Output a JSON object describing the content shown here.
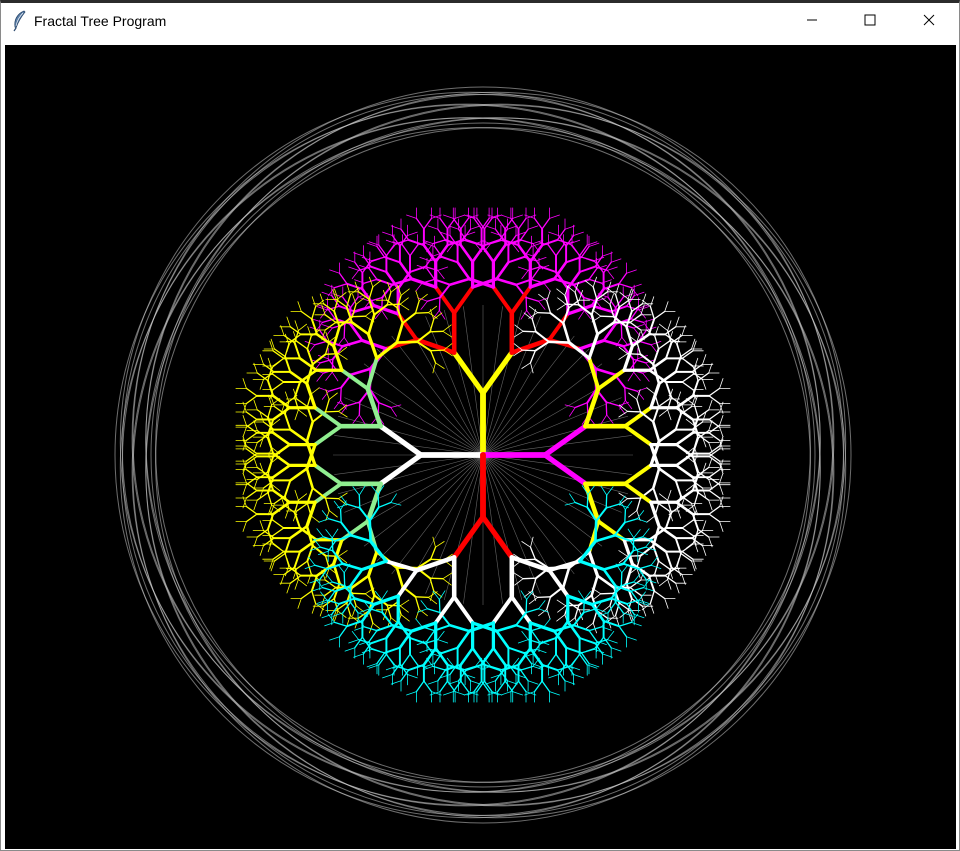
{
  "window": {
    "title": "Fractal Tree Program",
    "app_icon": "feather-icon",
    "controls": {
      "minimize": "minimize-icon",
      "maximize": "maximize-icon",
      "close": "close-icon"
    }
  },
  "canvas": {
    "background": "#000000",
    "circle_color": "#c8c8c8",
    "trees": [
      {
        "direction_deg": 90,
        "colors": [
          "#ffff00",
          "#ff0000",
          "#ff00ff"
        ]
      },
      {
        "direction_deg": 180,
        "colors": [
          "#ffffff",
          "#90ee90",
          "#ffff00"
        ]
      },
      {
        "direction_deg": 0,
        "colors": [
          "#ff00ff",
          "#ffff00",
          "#ffffff"
        ]
      },
      {
        "direction_deg": 270,
        "colors": [
          "#ff0000",
          "#ffffff",
          "#00ffff"
        ]
      }
    ]
  }
}
